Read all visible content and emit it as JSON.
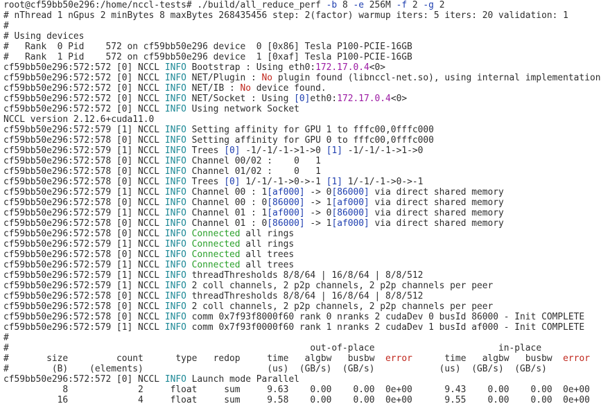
{
  "colors": {
    "background": "#ffffff",
    "default": "#2d2d2d",
    "blue": "#1f3fb0",
    "teal": "#1c8896",
    "green": "#2aa02a",
    "red": "#c0261c",
    "magenta": "#9c1aa3"
  },
  "terminal": {
    "lines": [
      [
        {
          "t": "root@cf59bb50e296:/home/nccl-tests# ./build/all_reduce_perf ",
          "c": "dflt"
        },
        {
          "t": "-b",
          "c": "blue"
        },
        {
          "t": " 8 ",
          "c": "dflt"
        },
        {
          "t": "-e",
          "c": "blue"
        },
        {
          "t": " 256M ",
          "c": "dflt"
        },
        {
          "t": "-f",
          "c": "blue"
        },
        {
          "t": " 2 ",
          "c": "dflt"
        },
        {
          "t": "-g",
          "c": "blue"
        },
        {
          "t": " 2",
          "c": "dflt"
        }
      ],
      [
        {
          "t": "# nThread 1 nGpus 2 minBytes 8 maxBytes 268435456 step: 2(factor) warmup iters: 5 iters: 20 validation: 1",
          "c": "dflt"
        }
      ],
      [
        {
          "t": "#",
          "c": "dflt"
        }
      ],
      [
        {
          "t": "# Using devices",
          "c": "dflt"
        }
      ],
      [
        {
          "t": "#   Rank  0 Pid    572 on cf59bb50e296 device  0 [0x86] Tesla P100-PCIE-16GB",
          "c": "dflt"
        }
      ],
      [
        {
          "t": "#   Rank  1 Pid    572 on cf59bb50e296 device  1 [0xaf] Tesla P100-PCIE-16GB",
          "c": "dflt"
        }
      ],
      [
        {
          "t": "cf59bb50e296:572:572 [0] NCCL ",
          "c": "dflt"
        },
        {
          "t": "INFO",
          "c": "teal"
        },
        {
          "t": " Bootstrap : Using eth0:",
          "c": "dflt"
        },
        {
          "t": "172.17.0.4",
          "c": "mag"
        },
        {
          "t": "<0>",
          "c": "dflt"
        }
      ],
      [
        {
          "t": "cf59bb50e296:572:572 [0] NCCL ",
          "c": "dflt"
        },
        {
          "t": "INFO",
          "c": "teal"
        },
        {
          "t": " NET/Plugin : ",
          "c": "dflt"
        },
        {
          "t": "No",
          "c": "red"
        },
        {
          "t": " plugin found (libnccl-net.so), using internal implementation",
          "c": "dflt"
        }
      ],
      [
        {
          "t": "cf59bb50e296:572:572 [0] NCCL ",
          "c": "dflt"
        },
        {
          "t": "INFO",
          "c": "teal"
        },
        {
          "t": " NET/IB : ",
          "c": "dflt"
        },
        {
          "t": "No",
          "c": "red"
        },
        {
          "t": " device found.",
          "c": "dflt"
        }
      ],
      [
        {
          "t": "cf59bb50e296:572:572 [0] NCCL ",
          "c": "dflt"
        },
        {
          "t": "INFO",
          "c": "teal"
        },
        {
          "t": " NET/Socket : Using ",
          "c": "dflt"
        },
        {
          "t": "[0]",
          "c": "blue"
        },
        {
          "t": "eth0:",
          "c": "dflt"
        },
        {
          "t": "172.17.0.4",
          "c": "mag"
        },
        {
          "t": "<0>",
          "c": "dflt"
        }
      ],
      [
        {
          "t": "cf59bb50e296:572:572 [0] NCCL ",
          "c": "dflt"
        },
        {
          "t": "INFO",
          "c": "teal"
        },
        {
          "t": " Using network Socket",
          "c": "dflt"
        }
      ],
      [
        {
          "t": "NCCL version 2.12.6+cuda11.0",
          "c": "dflt"
        }
      ],
      [
        {
          "t": "cf59bb50e296:572:579 [1] NCCL ",
          "c": "dflt"
        },
        {
          "t": "INFO",
          "c": "teal"
        },
        {
          "t": " Setting affinity for GPU 1 to fffc00,0fffc000",
          "c": "dflt"
        }
      ],
      [
        {
          "t": "cf59bb50e296:572:578 [0] NCCL ",
          "c": "dflt"
        },
        {
          "t": "INFO",
          "c": "teal"
        },
        {
          "t": " Setting affinity for GPU 0 to fffc00,0fffc000",
          "c": "dflt"
        }
      ],
      [
        {
          "t": "cf59bb50e296:572:579 [1] NCCL ",
          "c": "dflt"
        },
        {
          "t": "INFO",
          "c": "teal"
        },
        {
          "t": " Trees ",
          "c": "dflt"
        },
        {
          "t": "[0]",
          "c": "blue"
        },
        {
          "t": " -1/-1/-1->1->0 ",
          "c": "dflt"
        },
        {
          "t": "[1]",
          "c": "blue"
        },
        {
          "t": " -1/-1/-1->1->0",
          "c": "dflt"
        }
      ],
      [
        {
          "t": "cf59bb50e296:572:578 [0] NCCL ",
          "c": "dflt"
        },
        {
          "t": "INFO",
          "c": "teal"
        },
        {
          "t": " Channel 00/02 :    0   1",
          "c": "dflt"
        }
      ],
      [
        {
          "t": "cf59bb50e296:572:578 [0] NCCL ",
          "c": "dflt"
        },
        {
          "t": "INFO",
          "c": "teal"
        },
        {
          "t": " Channel 01/02 :    0   1",
          "c": "dflt"
        }
      ],
      [
        {
          "t": "cf59bb50e296:572:578 [0] NCCL ",
          "c": "dflt"
        },
        {
          "t": "INFO",
          "c": "teal"
        },
        {
          "t": " Trees ",
          "c": "dflt"
        },
        {
          "t": "[0]",
          "c": "blue"
        },
        {
          "t": " 1/-1/-1->0->-1 ",
          "c": "dflt"
        },
        {
          "t": "[1]",
          "c": "blue"
        },
        {
          "t": " 1/-1/-1->0->-1",
          "c": "dflt"
        }
      ],
      [
        {
          "t": "cf59bb50e296:572:579 [1] NCCL ",
          "c": "dflt"
        },
        {
          "t": "INFO",
          "c": "teal"
        },
        {
          "t": " Channel 00 : 1",
          "c": "dflt"
        },
        {
          "t": "[af000]",
          "c": "blue"
        },
        {
          "t": " -> 0",
          "c": "dflt"
        },
        {
          "t": "[86000]",
          "c": "blue"
        },
        {
          "t": " via direct shared memory",
          "c": "dflt"
        }
      ],
      [
        {
          "t": "cf59bb50e296:572:578 [0] NCCL ",
          "c": "dflt"
        },
        {
          "t": "INFO",
          "c": "teal"
        },
        {
          "t": " Channel 00 : 0",
          "c": "dflt"
        },
        {
          "t": "[86000]",
          "c": "blue"
        },
        {
          "t": " -> 1",
          "c": "dflt"
        },
        {
          "t": "[af000]",
          "c": "blue"
        },
        {
          "t": " via direct shared memory",
          "c": "dflt"
        }
      ],
      [
        {
          "t": "cf59bb50e296:572:579 [1] NCCL ",
          "c": "dflt"
        },
        {
          "t": "INFO",
          "c": "teal"
        },
        {
          "t": " Channel 01 : 1",
          "c": "dflt"
        },
        {
          "t": "[af000]",
          "c": "blue"
        },
        {
          "t": " -> 0",
          "c": "dflt"
        },
        {
          "t": "[86000]",
          "c": "blue"
        },
        {
          "t": " via direct shared memory",
          "c": "dflt"
        }
      ],
      [
        {
          "t": "cf59bb50e296:572:578 [0] NCCL ",
          "c": "dflt"
        },
        {
          "t": "INFO",
          "c": "teal"
        },
        {
          "t": " Channel 01 : 0",
          "c": "dflt"
        },
        {
          "t": "[86000]",
          "c": "blue"
        },
        {
          "t": " -> 1",
          "c": "dflt"
        },
        {
          "t": "[af000]",
          "c": "blue"
        },
        {
          "t": " via direct shared memory",
          "c": "dflt"
        }
      ],
      [
        {
          "t": "cf59bb50e296:572:578 [0] NCCL ",
          "c": "dflt"
        },
        {
          "t": "INFO",
          "c": "teal"
        },
        {
          "t": " ",
          "c": "dflt"
        },
        {
          "t": "Connected",
          "c": "green"
        },
        {
          "t": " all rings",
          "c": "dflt"
        }
      ],
      [
        {
          "t": "cf59bb50e296:572:579 [1] NCCL ",
          "c": "dflt"
        },
        {
          "t": "INFO",
          "c": "teal"
        },
        {
          "t": " ",
          "c": "dflt"
        },
        {
          "t": "Connected",
          "c": "green"
        },
        {
          "t": " all rings",
          "c": "dflt"
        }
      ],
      [
        {
          "t": "cf59bb50e296:572:578 [0] NCCL ",
          "c": "dflt"
        },
        {
          "t": "INFO",
          "c": "teal"
        },
        {
          "t": " ",
          "c": "dflt"
        },
        {
          "t": "Connected",
          "c": "green"
        },
        {
          "t": " all trees",
          "c": "dflt"
        }
      ],
      [
        {
          "t": "cf59bb50e296:572:579 [1] NCCL ",
          "c": "dflt"
        },
        {
          "t": "INFO",
          "c": "teal"
        },
        {
          "t": " ",
          "c": "dflt"
        },
        {
          "t": "Connected",
          "c": "green"
        },
        {
          "t": " all trees",
          "c": "dflt"
        }
      ],
      [
        {
          "t": "cf59bb50e296:572:579 [1] NCCL ",
          "c": "dflt"
        },
        {
          "t": "INFO",
          "c": "teal"
        },
        {
          "t": " threadThresholds 8/8/64 | 16/8/64 | 8/8/512",
          "c": "dflt"
        }
      ],
      [
        {
          "t": "cf59bb50e296:572:579 [1] NCCL ",
          "c": "dflt"
        },
        {
          "t": "INFO",
          "c": "teal"
        },
        {
          "t": " 2 coll channels, 2 p2p channels, 2 p2p channels per peer",
          "c": "dflt"
        }
      ],
      [
        {
          "t": "cf59bb50e296:572:578 [0] NCCL ",
          "c": "dflt"
        },
        {
          "t": "INFO",
          "c": "teal"
        },
        {
          "t": " threadThresholds 8/8/64 | 16/8/64 | 8/8/512",
          "c": "dflt"
        }
      ],
      [
        {
          "t": "cf59bb50e296:572:578 [0] NCCL ",
          "c": "dflt"
        },
        {
          "t": "INFO",
          "c": "teal"
        },
        {
          "t": " 2 coll channels, 2 p2p channels, 2 p2p channels per peer",
          "c": "dflt"
        }
      ],
      [
        {
          "t": "cf59bb50e296:572:578 [0] NCCL ",
          "c": "dflt"
        },
        {
          "t": "INFO",
          "c": "teal"
        },
        {
          "t": " comm 0x7f93f8000f60 rank 0 nranks 2 cudaDev 0 busId 86000 - Init COMPLETE",
          "c": "dflt"
        }
      ],
      [
        {
          "t": "cf59bb50e296:572:579 [1] NCCL ",
          "c": "dflt"
        },
        {
          "t": "INFO",
          "c": "teal"
        },
        {
          "t": " comm 0x7f93f0000f60 rank 1 nranks 2 cudaDev 1 busId af000 - Init COMPLETE",
          "c": "dflt"
        }
      ],
      [
        {
          "t": "#",
          "c": "dflt"
        }
      ],
      [
        {
          "t": "#                                                        out-of-place                       in-place",
          "c": "dflt"
        }
      ],
      [
        {
          "t": "#       size         count      type   redop     time   algbw   busbw  ",
          "c": "dflt"
        },
        {
          "t": "error",
          "c": "red"
        },
        {
          "t": "      time   algbw   busbw  ",
          "c": "dflt"
        },
        {
          "t": "error",
          "c": "red"
        }
      ],
      [
        {
          "t": "#        (B)    (elements)                       (us)  (GB/s)  (GB/s)            (us)  (GB/s)  (GB/s)",
          "c": "dflt"
        }
      ],
      [
        {
          "t": "cf59bb50e296:572:572 [0] NCCL ",
          "c": "dflt"
        },
        {
          "t": "INFO",
          "c": "teal"
        },
        {
          "t": " Launch mode Parallel",
          "c": "dflt"
        }
      ],
      [
        {
          "t": "           8             2     float     sum     9.63    0.00    0.00  0e+00      9.43    0.00    0.00  0e+00",
          "c": "dflt"
        }
      ],
      [
        {
          "t": "          16             4     float     sum     9.58    0.00    0.00  0e+00      9.55    0.00    0.00  0e+00",
          "c": "dflt"
        }
      ]
    ]
  }
}
